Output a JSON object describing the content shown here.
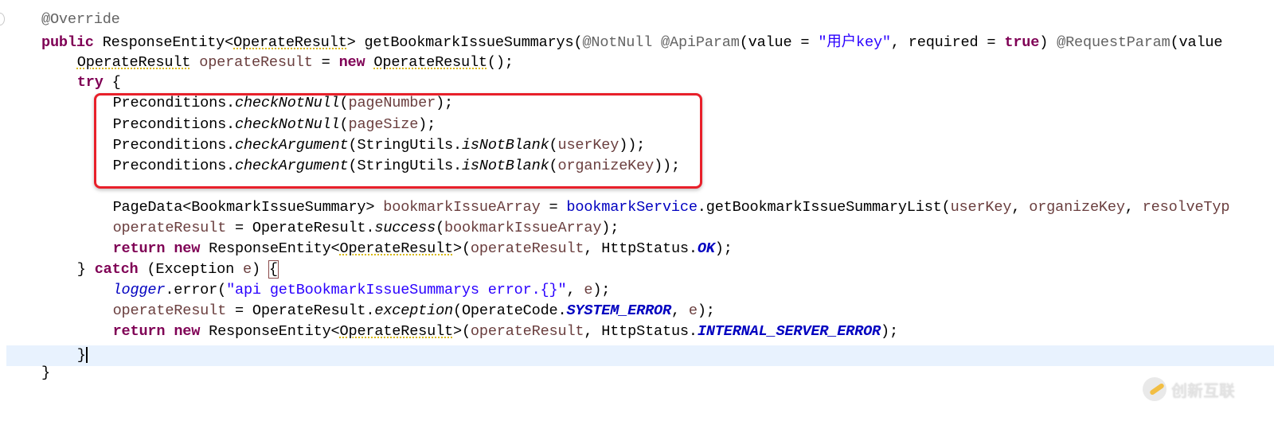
{
  "editor": {
    "lines": [
      {
        "indent": 0,
        "tokens": [
          [
            "@Override",
            "ann"
          ]
        ]
      },
      {
        "indent": 0,
        "tokens": [
          [
            "public",
            "kw"
          ],
          [
            " ResponseEntity<",
            ""
          ],
          [
            "OperateResult",
            "warn"
          ],
          [
            "> getBookmarkIssueSummarys(",
            ""
          ],
          [
            "@NotNull @ApiParam",
            "ann"
          ],
          [
            "(value = ",
            ""
          ],
          [
            "\"用户key\"",
            "str"
          ],
          [
            ", required = ",
            ""
          ],
          [
            "true",
            "kw"
          ],
          [
            ") ",
            ""
          ],
          [
            "@RequestParam",
            "ann"
          ],
          [
            "(value",
            ""
          ]
        ]
      },
      {
        "indent": 1,
        "tokens": [
          [
            "OperateResult",
            "warn"
          ],
          [
            " ",
            ""
          ],
          [
            "operateResult",
            "var"
          ],
          [
            " = ",
            ""
          ],
          [
            "new",
            "kw"
          ],
          [
            " ",
            ""
          ],
          [
            "OperateResult",
            "warn"
          ],
          [
            "();",
            ""
          ]
        ]
      },
      {
        "indent": 1,
        "tokens": [
          [
            "try",
            "kw"
          ],
          [
            " {",
            ""
          ]
        ]
      },
      {
        "indent": 2,
        "tokens": [
          [
            "Preconditions.",
            ""
          ],
          [
            "checkNotNull",
            "it"
          ],
          [
            "(",
            ""
          ],
          [
            "pageNumber",
            "var"
          ],
          [
            ");",
            ""
          ]
        ]
      },
      {
        "indent": 2,
        "tokens": [
          [
            "Preconditions.",
            ""
          ],
          [
            "checkNotNull",
            "it"
          ],
          [
            "(",
            ""
          ],
          [
            "pageSize",
            "var"
          ],
          [
            ");",
            ""
          ]
        ]
      },
      {
        "indent": 2,
        "tokens": [
          [
            "Preconditions.",
            ""
          ],
          [
            "checkArgument",
            "it"
          ],
          [
            "(StringUtils.",
            ""
          ],
          [
            "isNotBlank",
            "it"
          ],
          [
            "(",
            ""
          ],
          [
            "userKey",
            "var"
          ],
          [
            "));",
            ""
          ]
        ]
      },
      {
        "indent": 2,
        "tokens": [
          [
            "Preconditions.",
            ""
          ],
          [
            "checkArgument",
            "it"
          ],
          [
            "(StringUtils.",
            ""
          ],
          [
            "isNotBlank",
            "it"
          ],
          [
            "(",
            ""
          ],
          [
            "organizeKey",
            "var"
          ],
          [
            "));",
            ""
          ]
        ]
      },
      {
        "indent": 2,
        "tokens": []
      },
      {
        "indent": 2,
        "tokens": [
          [
            "PageData<BookmarkIssueSummary> ",
            ""
          ],
          [
            "bookmarkIssueArray",
            "var"
          ],
          [
            " = ",
            ""
          ],
          [
            "bookmarkService",
            "field"
          ],
          [
            ".getBookmarkIssueSummaryList(",
            ""
          ],
          [
            "userKey",
            "var"
          ],
          [
            ", ",
            ""
          ],
          [
            "organizeKey",
            "var"
          ],
          [
            ", ",
            ""
          ],
          [
            "resolveTyp",
            "var"
          ]
        ]
      },
      {
        "indent": 2,
        "tokens": [
          [
            "operateResult",
            "var"
          ],
          [
            " = OperateResult.",
            ""
          ],
          [
            "success",
            "it"
          ],
          [
            "(",
            ""
          ],
          [
            "bookmarkIssueArray",
            "var"
          ],
          [
            ");",
            ""
          ]
        ]
      },
      {
        "indent": 2,
        "tokens": [
          [
            "return",
            "kw"
          ],
          [
            " ",
            ""
          ],
          [
            "new",
            "kw"
          ],
          [
            " ResponseEntity<",
            ""
          ],
          [
            "OperateResult",
            "warn"
          ],
          [
            ">(",
            ""
          ],
          [
            "operateResult",
            "var"
          ],
          [
            ", HttpStatus.",
            ""
          ],
          [
            "OK",
            "const"
          ],
          [
            ");",
            ""
          ]
        ]
      },
      {
        "indent": 1,
        "tokens": [
          [
            "} ",
            ""
          ],
          [
            "catch",
            "kw"
          ],
          [
            " (Exception ",
            ""
          ],
          [
            "e",
            "var"
          ],
          [
            ") ",
            ""
          ],
          [
            "{",
            "brk"
          ]
        ]
      },
      {
        "indent": 2,
        "tokens": [
          [
            "logger",
            "sfield"
          ],
          [
            ".error(",
            ""
          ],
          [
            "\"api getBookmarkIssueSummarys error.{}\"",
            "str"
          ],
          [
            ", ",
            ""
          ],
          [
            "e",
            "var"
          ],
          [
            ");",
            ""
          ]
        ]
      },
      {
        "indent": 2,
        "tokens": [
          [
            "operateResult",
            "var"
          ],
          [
            " = OperateResult.",
            ""
          ],
          [
            "exception",
            "it"
          ],
          [
            "(OperateCode.",
            ""
          ],
          [
            "SYSTEM_ERROR",
            "const"
          ],
          [
            ", ",
            ""
          ],
          [
            "e",
            "var"
          ],
          [
            ");",
            ""
          ]
        ]
      },
      {
        "indent": 2,
        "tokens": [
          [
            "return",
            "kw"
          ],
          [
            " ",
            ""
          ],
          [
            "new",
            "kw"
          ],
          [
            " ResponseEntity<",
            ""
          ],
          [
            "OperateResult",
            "warn"
          ],
          [
            ">(",
            ""
          ],
          [
            "operateResult",
            "var"
          ],
          [
            ", HttpStatus.",
            ""
          ],
          [
            "INTERNAL_SERVER_ERROR",
            "const"
          ],
          [
            ");",
            ""
          ]
        ]
      },
      {
        "indent": 1,
        "tokens": [
          [
            "}",
            ""
          ]
        ],
        "caret": true
      },
      {
        "indent": 0,
        "tokens": [
          [
            "}",
            ""
          ]
        ]
      }
    ]
  },
  "highlight_color": "#e8202a",
  "watermark": {
    "text": "创新互联"
  }
}
